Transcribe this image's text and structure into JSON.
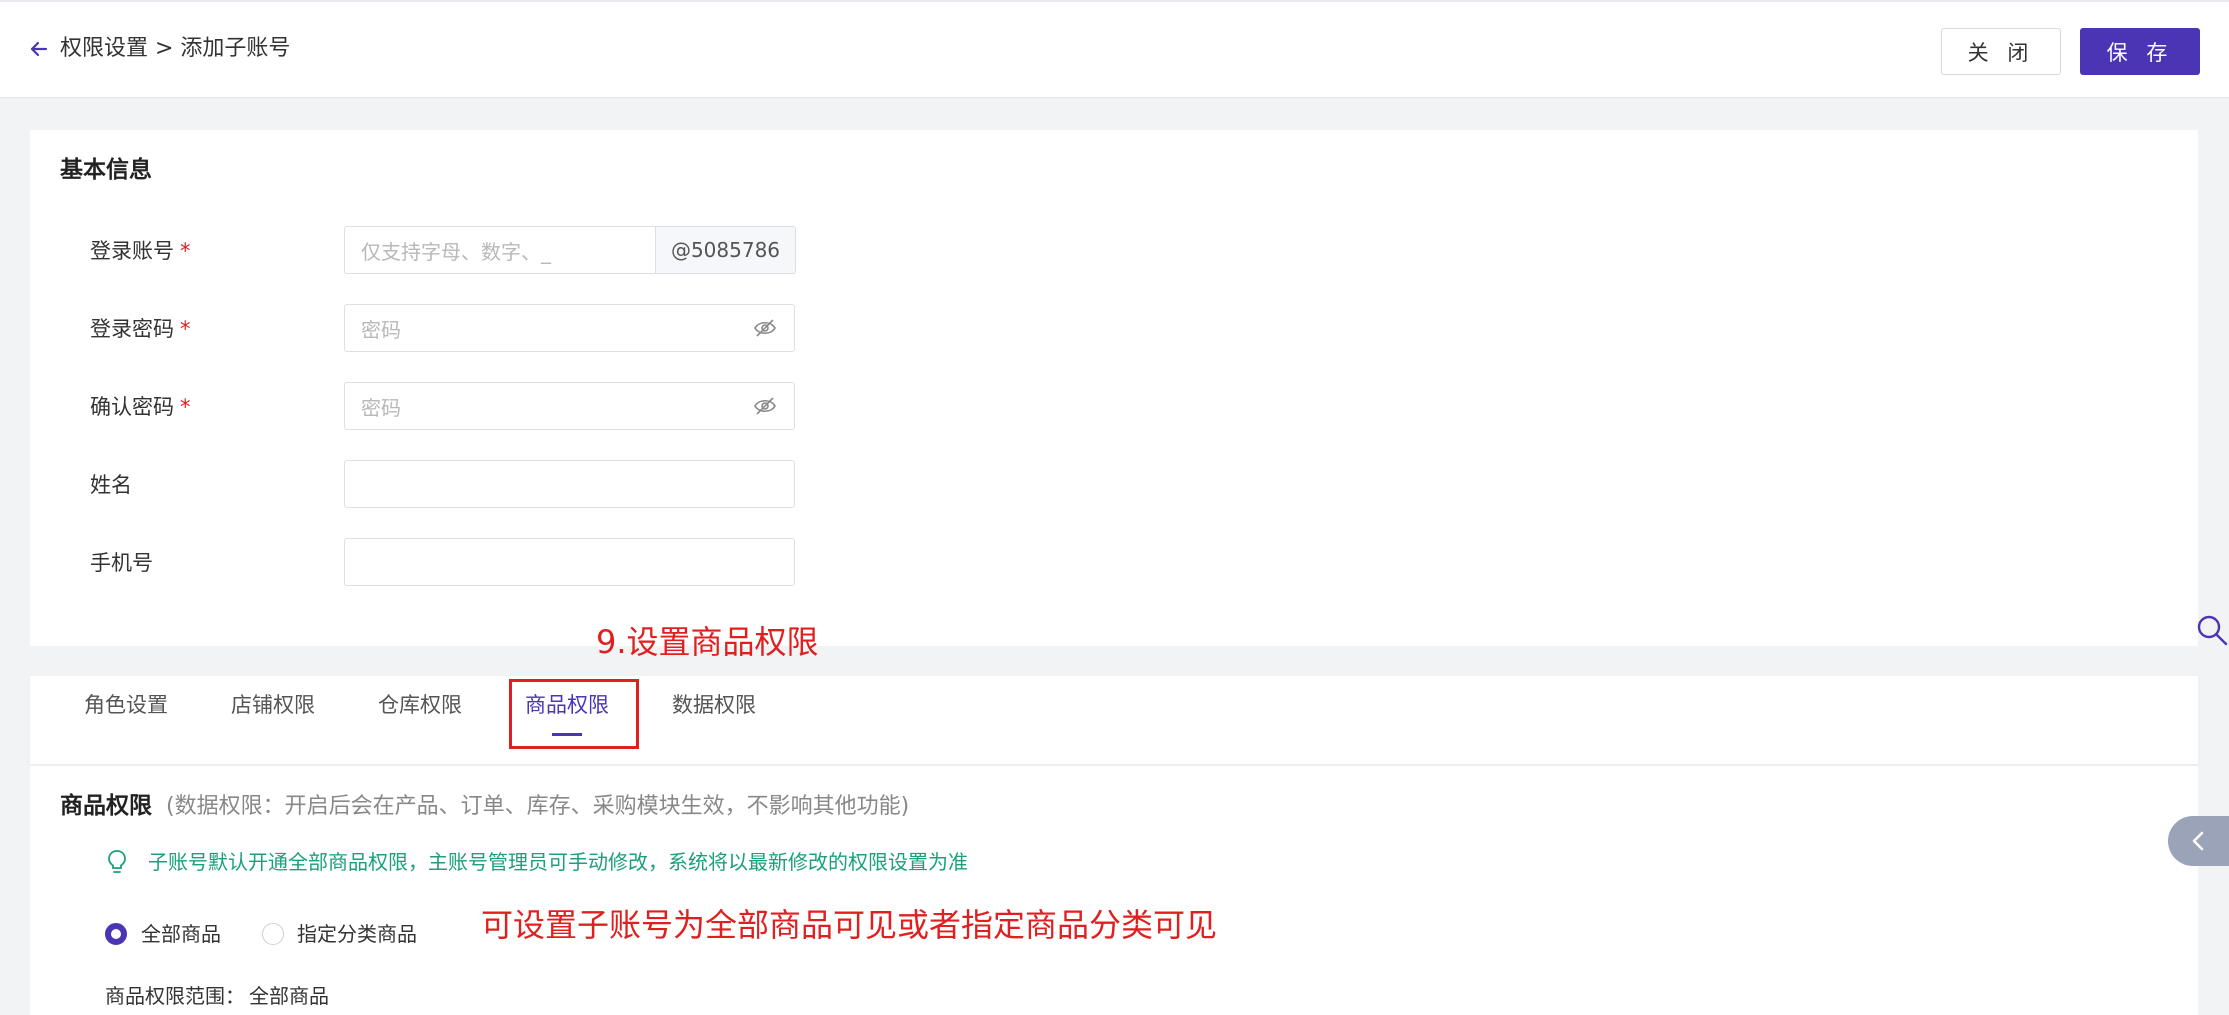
{
  "header": {
    "breadcrumb": "权限设置 > 添加子账号",
    "close_label": "关 闭",
    "save_label": "保 存"
  },
  "basic_info": {
    "title": "基本信息",
    "fields": [
      {
        "label": "登录账号",
        "required": true,
        "placeholder": "仅支持字母、数字、_",
        "suffix": "@5085786"
      },
      {
        "label": "登录密码",
        "required": true,
        "placeholder": "密码"
      },
      {
        "label": "确认密码",
        "required": true,
        "placeholder": "密码"
      },
      {
        "label": "姓名",
        "required": false,
        "placeholder": ""
      },
      {
        "label": "手机号",
        "required": false,
        "placeholder": ""
      }
    ],
    "required_mark": "*"
  },
  "annotations": {
    "step": "9.设置商品权限",
    "note": "可设置子账号为全部商品可见或者指定商品分类可见"
  },
  "tabs": [
    {
      "label": "角色设置",
      "active": false
    },
    {
      "label": "店铺权限",
      "active": false
    },
    {
      "label": "仓库权限",
      "active": false
    },
    {
      "label": "商品权限",
      "active": true
    },
    {
      "label": "数据权限",
      "active": false
    }
  ],
  "product_permission": {
    "title": "商品权限",
    "subtitle": "(数据权限：开启后会在产品、订单、库存、采购模块生效，不影响其他功能)",
    "hint": "子账号默认开通全部商品权限，主账号管理员可手动修改，系统将以最新修改的权限设置为准",
    "options": [
      {
        "label": "全部商品",
        "checked": true
      },
      {
        "label": "指定分类商品",
        "checked": false
      }
    ],
    "scope_label": "商品权限范围：",
    "scope_value": "全部商品"
  },
  "colors": {
    "primary": "#4b35b4",
    "annotation": "#e02020",
    "hint": "#1aa07c"
  },
  "icons": {
    "back": "arrow-left-icon",
    "eye": "eye-off-icon",
    "bulb": "bulb-icon",
    "search": "search-icon",
    "collapse": "chevron-left-icon"
  }
}
